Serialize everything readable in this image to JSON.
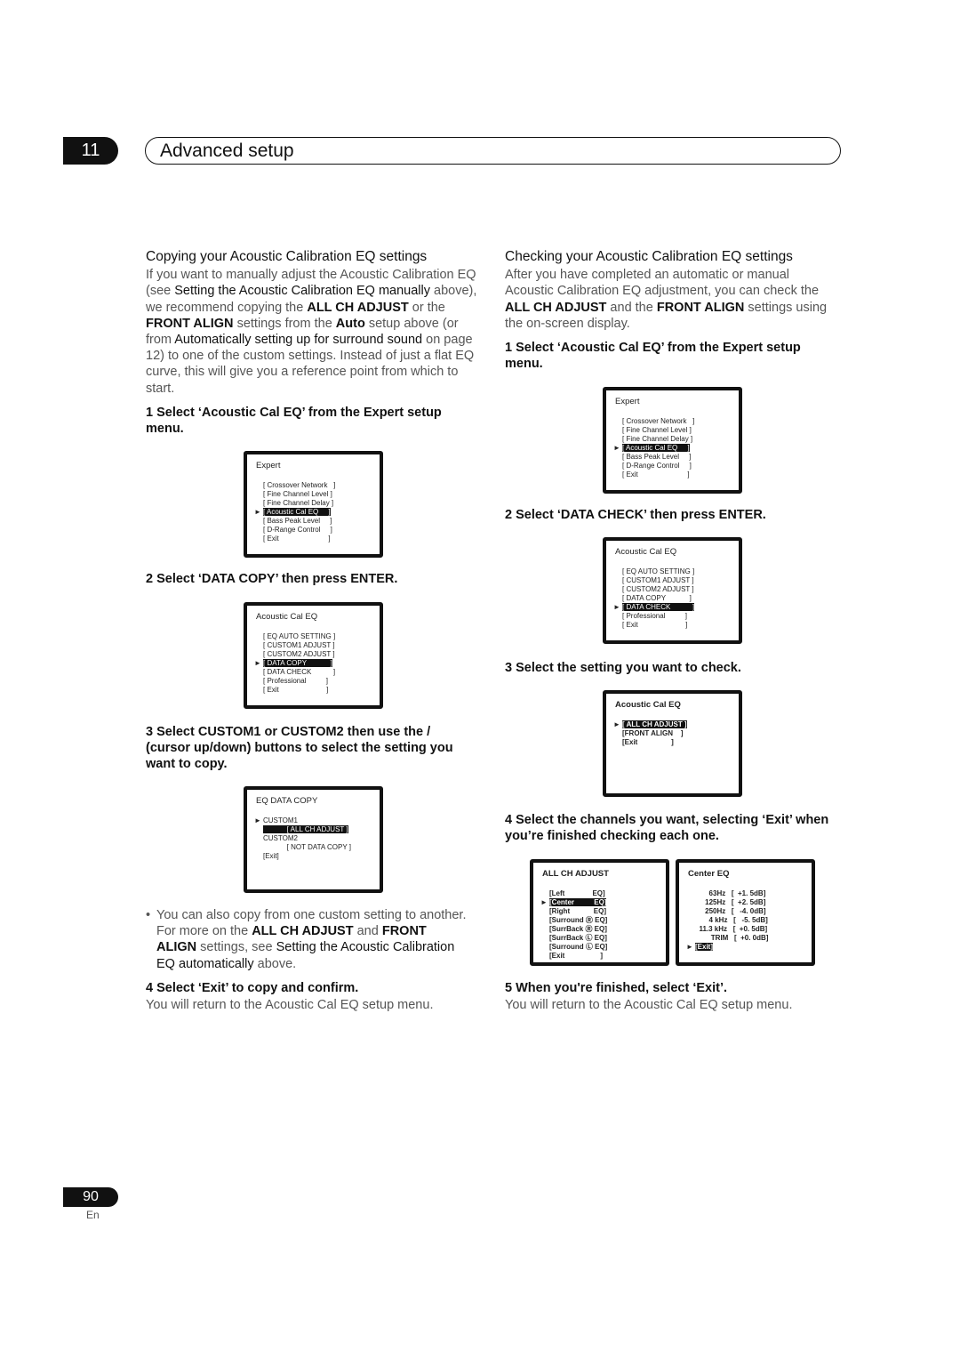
{
  "header": {
    "chapter": "11",
    "title": "Advanced setup"
  },
  "left": {
    "heading": "Copying your Acoustic Calibration EQ settings",
    "intro": [
      "If you want to manually adjust the Acoustic Calibration EQ (see ",
      "Setting the Acoustic Calibration EQ manually",
      " above), we recommend copying the ",
      "ALL CH ADJUST",
      " or the ",
      "FRONT ALIGN",
      " settings from the ",
      "Auto",
      " setup above (or from ",
      "Automatically setting up for surround sound",
      " on page 12) to one of the custom settings. Instead of just a flat EQ curve, this will give you a reference point from which to start."
    ],
    "step1": "1   Select ‘Acoustic Cal EQ’ from the Expert setup menu.",
    "step2": "2   Select ‘DATA COPY’ then press ENTER.",
    "step3": "3   Select CUSTOM1 or CUSTOM2 then use the / (cursor up/down) buttons to select the setting you want to copy.",
    "bullet": [
      "You can also copy from one custom setting to another. For more on the ",
      "ALL CH ADJUST",
      " and ",
      "FRONT ALIGN",
      " settings, see ",
      "Setting the Acoustic Calibration EQ automatically",
      " above."
    ],
    "step4": "4   Select ‘Exit’ to copy and confirm.",
    "step4_text": "You will return to the Acoustic Cal EQ setup menu."
  },
  "right": {
    "heading": "Checking your Acoustic Calibration EQ settings",
    "intro": [
      "After you have completed an automatic or manual Acoustic Calibration EQ adjustment, you can check the ",
      "ALL CH ADJUST",
      " and the ",
      "FRONT ALIGN",
      " settings using the on-screen display."
    ],
    "step1": "1   Select ‘Acoustic Cal EQ’ from the Expert setup menu.",
    "step2": "2   Select ‘DATA CHECK’ then press ENTER.",
    "step3": "3   Select the setting you want to check.",
    "step4": "4   Select the channels you want, selecting ‘Exit’ when you’re finished checking each one.",
    "step5": "5   When you're finished, select ‘Exit’.",
    "step5_text": "You will return to the Acoustic Cal EQ setup menu."
  },
  "screens": {
    "expert": {
      "title": "Expert",
      "items": [
        "[ Crossover Network   ]",
        "[ Fine Channel Level ]",
        "[ Fine Channel Delay ]",
        "[ Acoustic Cal EQ     ]",
        "[ Bass Peak Level     ]",
        "[ D-Range Control     ]",
        "[ Exit                         ]"
      ],
      "selected": 3
    },
    "cal_copy": {
      "title": "Acoustic  Cal  EQ",
      "items": [
        "[ EQ AUTO SETTING ]",
        "[ CUSTOM1 ADJUST ]",
        "[ CUSTOM2 ADJUST ]",
        "[ DATA COPY            ]",
        "[ DATA CHECK           ]",
        "[ Professional          ]",
        "[ Exit                        ]"
      ],
      "selected": 3
    },
    "cal_check": {
      "title": "Acoustic  Cal  EQ",
      "items": [
        "[ EQ AUTO SETTING ]",
        "[ CUSTOM1 ADJUST ]",
        "[ CUSTOM2 ADJUST ]",
        "[ DATA COPY            ]",
        "[ DATA CHECK           ]",
        "[ Professional          ]",
        "[ Exit                        ]"
      ],
      "selected": 4
    },
    "eq_copy": {
      "title": "EQ  DATA  COPY",
      "items": [
        "CUSTOM1",
        "            [ ALL CH ADJUST ]",
        "CUSTOM2",
        "            [ NOT DATA COPY ]",
        "[Exit]"
      ],
      "selected": 0,
      "highlight": 1
    },
    "check_setting": {
      "title": "Acoustic  Cal  EQ",
      "items": [
        "[ ALL CH ADJUST ]",
        "[FRONT ALIGN    ]",
        "[Exit                 ]"
      ],
      "selected": 0
    },
    "all_ch": {
      "title": "ALL  CH  ADJUST",
      "items": [
        "[Left              EQ]",
        "[Center          EQ]",
        "[Right            EQ]",
        "[Surround Ⓡ EQ]",
        "[SurrBack Ⓡ EQ]",
        "[SurrBack Ⓛ EQ]",
        "[Surround Ⓛ EQ]",
        "[Exit                  ]"
      ],
      "selected": 1
    },
    "center_eq": {
      "title": "Center  EQ",
      "items": [
        "       63Hz   [  +1. 5dB]",
        "     125Hz   [  +2. 5dB]",
        "     250Hz   [   -4. 0dB]",
        "       4 kHz   [   -5. 5dB]",
        "  11.3 kHz   [  +0. 5dB]",
        "        TRIM   [  +0. 0dB]",
        "[Exit]"
      ],
      "selected": 6
    }
  },
  "footer": {
    "page": "90",
    "lang": "En"
  }
}
